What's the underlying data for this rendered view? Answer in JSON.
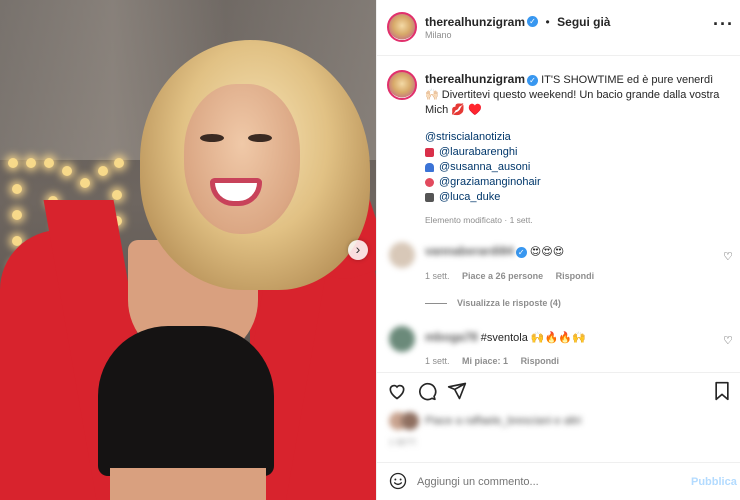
{
  "post": {
    "username": "therealhunzigram",
    "follow_label": "Segui già",
    "location": "Milano",
    "caption_text": "IT'S SHOWTIME ed è pure venerdì 🙌🏻 Divertitevi questo weekend! Un bacio grande dalla vostra Mich 💋 ♥️",
    "mentions": [
      {
        "icon": "",
        "handle": "@striscialanotizia"
      },
      {
        "icon": "lipstick",
        "handle": "@laurabarenghi"
      },
      {
        "icon": "dress",
        "handle": "@susanna_ausoni"
      },
      {
        "icon": "ribbon",
        "handle": "@graziamanginohair"
      },
      {
        "icon": "camera",
        "handle": "@luca_duke"
      }
    ],
    "edited_note": "Elemento modificato · 1 sett.",
    "brand_color": "#e1306c",
    "link_color": "#00376b"
  },
  "comments": [
    {
      "user_blurred": "vannaberardi84",
      "text": "😍😍😍",
      "time": "1 sett.",
      "likes": "Piace a 26 persone",
      "reply_label": "Rispondi",
      "view_replies": "Visualizza le risposte (4)"
    },
    {
      "user_blurred": "mboga78",
      "text": "#sventola 🙌🔥🔥🙌",
      "time": "1 sett.",
      "likes": "Mi piace: 1",
      "reply_label": "Rispondi"
    }
  ],
  "likes_line": "Piace a raffaele_bresciani e altri",
  "date_blurred": "1 SETT.",
  "add_comment": {
    "placeholder": "Aggiungi un commento...",
    "publish_label": "Pubblica"
  }
}
